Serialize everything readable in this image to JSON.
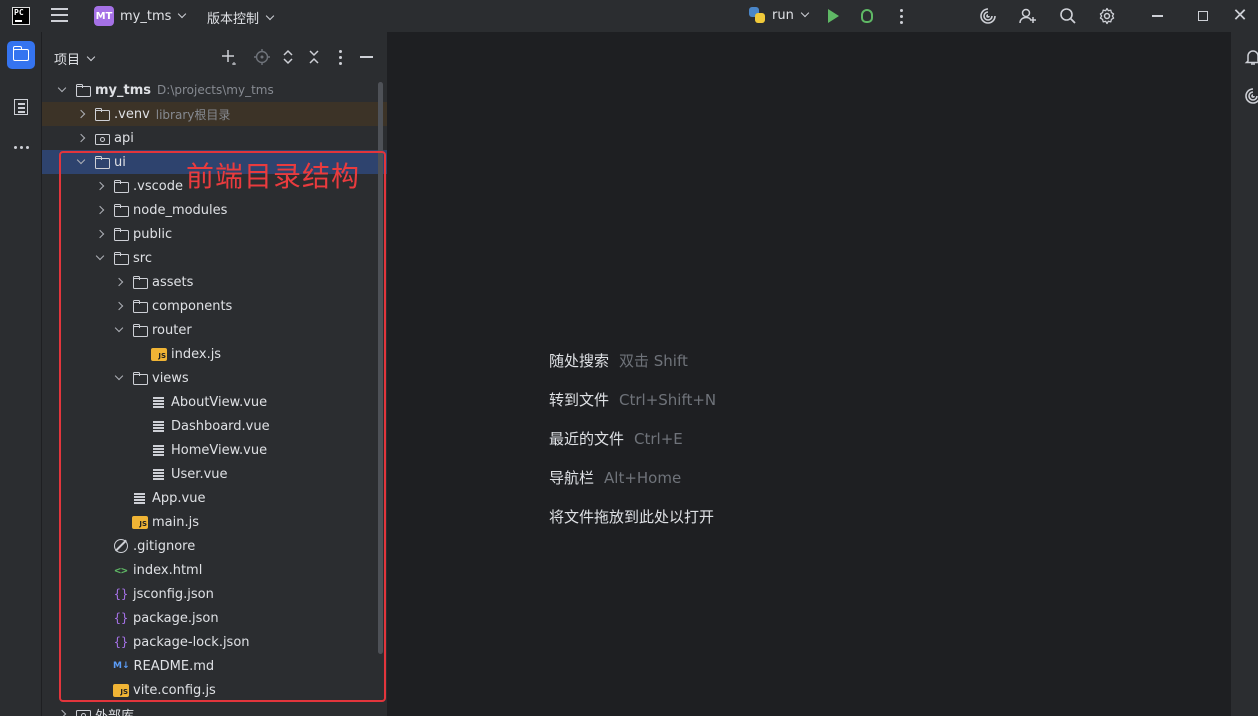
{
  "titlebar": {
    "app_logo": "PC",
    "project_badge": "MT",
    "project_name": "my_tms",
    "vcs_label": "版本控制",
    "run_config": "run"
  },
  "panel": {
    "title": "项目"
  },
  "tree": [
    {
      "label": "my_tms",
      "hint": "D:\\projects\\my_tms",
      "depth": 0,
      "arrow": "open",
      "icon": "folder",
      "bold": true
    },
    {
      "label": ".venv",
      "hint": "library根目录",
      "depth": 1,
      "arrow": "closed",
      "icon": "folder",
      "style": "venv"
    },
    {
      "label": "api",
      "depth": 1,
      "arrow": "closed",
      "icon": "module"
    },
    {
      "label": "ui",
      "depth": 1,
      "arrow": "open",
      "icon": "folder",
      "style": "selected"
    },
    {
      "label": ".vscode",
      "depth": 2,
      "arrow": "closed",
      "icon": "folder"
    },
    {
      "label": "node_modules",
      "depth": 2,
      "arrow": "closed",
      "icon": "folder"
    },
    {
      "label": "public",
      "depth": 2,
      "arrow": "closed",
      "icon": "folder"
    },
    {
      "label": "src",
      "depth": 2,
      "arrow": "open",
      "icon": "folder"
    },
    {
      "label": "assets",
      "depth": 3,
      "arrow": "closed",
      "icon": "folder"
    },
    {
      "label": "components",
      "depth": 3,
      "arrow": "closed",
      "icon": "folder"
    },
    {
      "label": "router",
      "depth": 3,
      "arrow": "open",
      "icon": "folder"
    },
    {
      "label": "index.js",
      "depth": 4,
      "arrow": "none",
      "icon": "js"
    },
    {
      "label": "views",
      "depth": 3,
      "arrow": "open",
      "icon": "folder"
    },
    {
      "label": "AboutView.vue",
      "depth": 4,
      "arrow": "none",
      "icon": "vue"
    },
    {
      "label": "Dashboard.vue",
      "depth": 4,
      "arrow": "none",
      "icon": "vue"
    },
    {
      "label": "HomeView.vue",
      "depth": 4,
      "arrow": "none",
      "icon": "vue"
    },
    {
      "label": "User.vue",
      "depth": 4,
      "arrow": "none",
      "icon": "vue"
    },
    {
      "label": "App.vue",
      "depth": 3,
      "arrow": "none",
      "icon": "vue"
    },
    {
      "label": "main.js",
      "depth": 3,
      "arrow": "none",
      "icon": "js"
    },
    {
      "label": ".gitignore",
      "depth": 2,
      "arrow": "none",
      "icon": "ignore"
    },
    {
      "label": "index.html",
      "depth": 2,
      "arrow": "none",
      "icon": "html"
    },
    {
      "label": "jsconfig.json",
      "depth": 2,
      "arrow": "none",
      "icon": "json"
    },
    {
      "label": "package.json",
      "depth": 2,
      "arrow": "none",
      "icon": "json"
    },
    {
      "label": "package-lock.json",
      "depth": 2,
      "arrow": "none",
      "icon": "json"
    },
    {
      "label": "README.md",
      "depth": 2,
      "arrow": "none",
      "icon": "md"
    },
    {
      "label": "vite.config.js",
      "depth": 2,
      "arrow": "none",
      "icon": "js"
    },
    {
      "label": "外部库",
      "depth": 0,
      "arrow": "closed",
      "icon": "library"
    }
  ],
  "annotation": {
    "text": "前端目录结构"
  },
  "editor_tips": [
    {
      "label": "随处搜索",
      "shortcut": "双击 Shift"
    },
    {
      "label": "转到文件",
      "shortcut": "Ctrl+Shift+N"
    },
    {
      "label": "最近的文件",
      "shortcut": "Ctrl+E"
    },
    {
      "label": "导航栏",
      "shortcut": "Alt+Home"
    },
    {
      "label": "将文件拖放到此处以打开",
      "shortcut": ""
    }
  ],
  "icon_glyphs": {
    "js": "JS",
    "html": "<>",
    "json": "{}",
    "md": "M↓"
  },
  "colors": {
    "accent": "#3574f0",
    "annotation": "#e2353c",
    "selected_row": "#2e436e",
    "venv_row": "#3c3327"
  }
}
